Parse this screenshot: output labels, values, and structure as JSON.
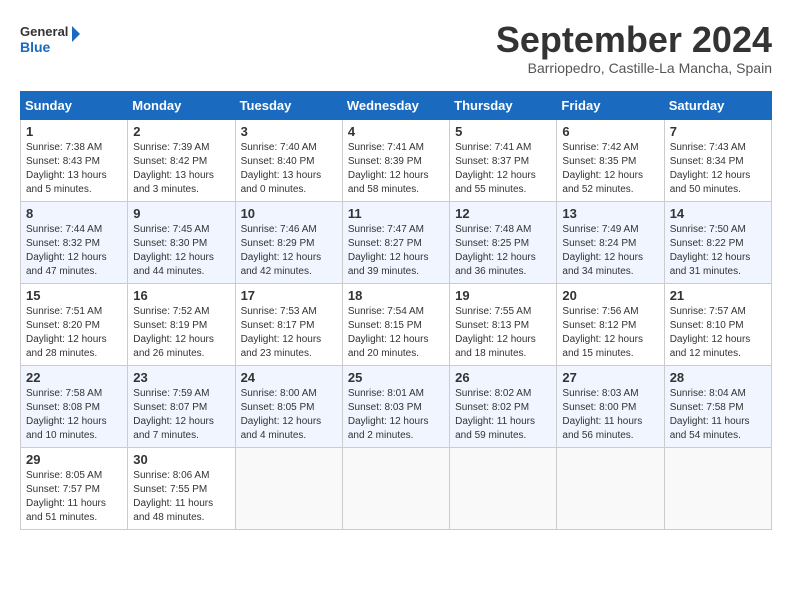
{
  "header": {
    "logo_line1": "General",
    "logo_line2": "Blue",
    "month_title": "September 2024",
    "location": "Barriopedro, Castille-La Mancha, Spain"
  },
  "days_of_week": [
    "Sunday",
    "Monday",
    "Tuesday",
    "Wednesday",
    "Thursday",
    "Friday",
    "Saturday"
  ],
  "weeks": [
    [
      {
        "day": "1",
        "sunrise": "Sunrise: 7:38 AM",
        "sunset": "Sunset: 8:43 PM",
        "daylight": "Daylight: 13 hours and 5 minutes."
      },
      {
        "day": "2",
        "sunrise": "Sunrise: 7:39 AM",
        "sunset": "Sunset: 8:42 PM",
        "daylight": "Daylight: 13 hours and 3 minutes."
      },
      {
        "day": "3",
        "sunrise": "Sunrise: 7:40 AM",
        "sunset": "Sunset: 8:40 PM",
        "daylight": "Daylight: 13 hours and 0 minutes."
      },
      {
        "day": "4",
        "sunrise": "Sunrise: 7:41 AM",
        "sunset": "Sunset: 8:39 PM",
        "daylight": "Daylight: 12 hours and 58 minutes."
      },
      {
        "day": "5",
        "sunrise": "Sunrise: 7:41 AM",
        "sunset": "Sunset: 8:37 PM",
        "daylight": "Daylight: 12 hours and 55 minutes."
      },
      {
        "day": "6",
        "sunrise": "Sunrise: 7:42 AM",
        "sunset": "Sunset: 8:35 PM",
        "daylight": "Daylight: 12 hours and 52 minutes."
      },
      {
        "day": "7",
        "sunrise": "Sunrise: 7:43 AM",
        "sunset": "Sunset: 8:34 PM",
        "daylight": "Daylight: 12 hours and 50 minutes."
      }
    ],
    [
      {
        "day": "8",
        "sunrise": "Sunrise: 7:44 AM",
        "sunset": "Sunset: 8:32 PM",
        "daylight": "Daylight: 12 hours and 47 minutes."
      },
      {
        "day": "9",
        "sunrise": "Sunrise: 7:45 AM",
        "sunset": "Sunset: 8:30 PM",
        "daylight": "Daylight: 12 hours and 44 minutes."
      },
      {
        "day": "10",
        "sunrise": "Sunrise: 7:46 AM",
        "sunset": "Sunset: 8:29 PM",
        "daylight": "Daylight: 12 hours and 42 minutes."
      },
      {
        "day": "11",
        "sunrise": "Sunrise: 7:47 AM",
        "sunset": "Sunset: 8:27 PM",
        "daylight": "Daylight: 12 hours and 39 minutes."
      },
      {
        "day": "12",
        "sunrise": "Sunrise: 7:48 AM",
        "sunset": "Sunset: 8:25 PM",
        "daylight": "Daylight: 12 hours and 36 minutes."
      },
      {
        "day": "13",
        "sunrise": "Sunrise: 7:49 AM",
        "sunset": "Sunset: 8:24 PM",
        "daylight": "Daylight: 12 hours and 34 minutes."
      },
      {
        "day": "14",
        "sunrise": "Sunrise: 7:50 AM",
        "sunset": "Sunset: 8:22 PM",
        "daylight": "Daylight: 12 hours and 31 minutes."
      }
    ],
    [
      {
        "day": "15",
        "sunrise": "Sunrise: 7:51 AM",
        "sunset": "Sunset: 8:20 PM",
        "daylight": "Daylight: 12 hours and 28 minutes."
      },
      {
        "day": "16",
        "sunrise": "Sunrise: 7:52 AM",
        "sunset": "Sunset: 8:19 PM",
        "daylight": "Daylight: 12 hours and 26 minutes."
      },
      {
        "day": "17",
        "sunrise": "Sunrise: 7:53 AM",
        "sunset": "Sunset: 8:17 PM",
        "daylight": "Daylight: 12 hours and 23 minutes."
      },
      {
        "day": "18",
        "sunrise": "Sunrise: 7:54 AM",
        "sunset": "Sunset: 8:15 PM",
        "daylight": "Daylight: 12 hours and 20 minutes."
      },
      {
        "day": "19",
        "sunrise": "Sunrise: 7:55 AM",
        "sunset": "Sunset: 8:13 PM",
        "daylight": "Daylight: 12 hours and 18 minutes."
      },
      {
        "day": "20",
        "sunrise": "Sunrise: 7:56 AM",
        "sunset": "Sunset: 8:12 PM",
        "daylight": "Daylight: 12 hours and 15 minutes."
      },
      {
        "day": "21",
        "sunrise": "Sunrise: 7:57 AM",
        "sunset": "Sunset: 8:10 PM",
        "daylight": "Daylight: 12 hours and 12 minutes."
      }
    ],
    [
      {
        "day": "22",
        "sunrise": "Sunrise: 7:58 AM",
        "sunset": "Sunset: 8:08 PM",
        "daylight": "Daylight: 12 hours and 10 minutes."
      },
      {
        "day": "23",
        "sunrise": "Sunrise: 7:59 AM",
        "sunset": "Sunset: 8:07 PM",
        "daylight": "Daylight: 12 hours and 7 minutes."
      },
      {
        "day": "24",
        "sunrise": "Sunrise: 8:00 AM",
        "sunset": "Sunset: 8:05 PM",
        "daylight": "Daylight: 12 hours and 4 minutes."
      },
      {
        "day": "25",
        "sunrise": "Sunrise: 8:01 AM",
        "sunset": "Sunset: 8:03 PM",
        "daylight": "Daylight: 12 hours and 2 minutes."
      },
      {
        "day": "26",
        "sunrise": "Sunrise: 8:02 AM",
        "sunset": "Sunset: 8:02 PM",
        "daylight": "Daylight: 11 hours and 59 minutes."
      },
      {
        "day": "27",
        "sunrise": "Sunrise: 8:03 AM",
        "sunset": "Sunset: 8:00 PM",
        "daylight": "Daylight: 11 hours and 56 minutes."
      },
      {
        "day": "28",
        "sunrise": "Sunrise: 8:04 AM",
        "sunset": "Sunset: 7:58 PM",
        "daylight": "Daylight: 11 hours and 54 minutes."
      }
    ],
    [
      {
        "day": "29",
        "sunrise": "Sunrise: 8:05 AM",
        "sunset": "Sunset: 7:57 PM",
        "daylight": "Daylight: 11 hours and 51 minutes."
      },
      {
        "day": "30",
        "sunrise": "Sunrise: 8:06 AM",
        "sunset": "Sunset: 7:55 PM",
        "daylight": "Daylight: 11 hours and 48 minutes."
      },
      {
        "day": "",
        "sunrise": "",
        "sunset": "",
        "daylight": ""
      },
      {
        "day": "",
        "sunrise": "",
        "sunset": "",
        "daylight": ""
      },
      {
        "day": "",
        "sunrise": "",
        "sunset": "",
        "daylight": ""
      },
      {
        "day": "",
        "sunrise": "",
        "sunset": "",
        "daylight": ""
      },
      {
        "day": "",
        "sunrise": "",
        "sunset": "",
        "daylight": ""
      }
    ]
  ]
}
